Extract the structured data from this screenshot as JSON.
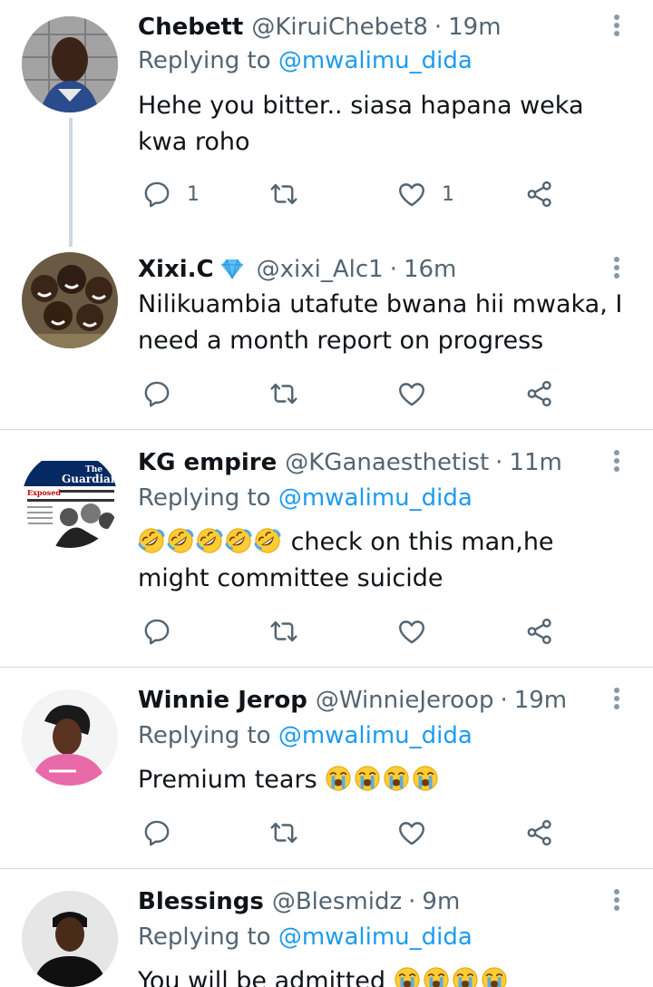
{
  "tweets": [
    {
      "name": "Chebett",
      "handle": "@KiruiChebet8",
      "time": "19m",
      "replying_prefix": "Replying to ",
      "replying_to": "@mwalimu_dida",
      "text_line1": "Hehe you bitter.. siasa hapana weka",
      "text_line2": "kwa roho",
      "reply_count": "1",
      "retweet_count": "",
      "like_count": "1"
    },
    {
      "name": "Xixi.C",
      "handle": "@xixi_Alc1",
      "time": "16m",
      "verified_emoji": "gem-icon",
      "text_line1": "Nilikuambia utafute bwana hii mwaka, I",
      "text_line2": "need a month report on progress",
      "reply_count": "",
      "retweet_count": "",
      "like_count": ""
    },
    {
      "name": "KG empire",
      "handle": "@KGanaesthetist",
      "time": "11m",
      "replying_prefix": "Replying to ",
      "replying_to": "@mwalimu_dida",
      "emoji_count": 5,
      "text_after_emoji": " check on this man,he",
      "text_line2": "might committee suicide",
      "reply_count": "",
      "retweet_count": "",
      "like_count": ""
    },
    {
      "name": "Winnie Jerop",
      "handle": "@WinnieJeroop",
      "time": "19m",
      "replying_prefix": "Replying to ",
      "replying_to": "@mwalimu_dida",
      "text_before_emoji": "Premium tears ",
      "emoji_count": 4,
      "reply_count": "",
      "retweet_count": "",
      "like_count": ""
    },
    {
      "name": "Blessings",
      "handle": "@Blesmidz",
      "time": "9m",
      "replying_prefix": "Replying to ",
      "replying_to": "@mwalimu_dida",
      "text_before_emoji": "You will be admitted ",
      "emoji_count": 4
    }
  ],
  "separator": "·",
  "colors": {
    "text": "#0f1419",
    "secondary": "#536471",
    "link": "#1d9bf0",
    "divider": "#cfd9de"
  },
  "avatar_guardian_text": {
    "masthead_line1": "The",
    "masthead_line2": "Guardian",
    "headline": "Exposed"
  },
  "icons": [
    "reply-icon",
    "retweet-icon",
    "like-icon",
    "share-icon",
    "more-icon",
    "rofl-emoji",
    "sob-emoji"
  ]
}
